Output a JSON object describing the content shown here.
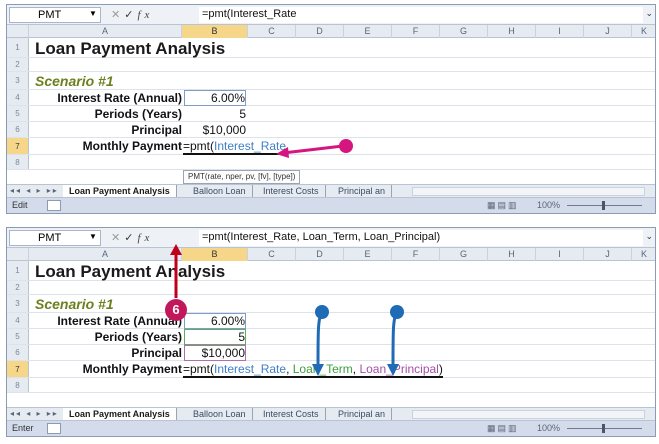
{
  "colors": {
    "callout": "#c2185b",
    "arrow_pink": "#d4167e",
    "arrow_blue": "#1f6bb5",
    "arrow_red": "#c0001a",
    "scenario_green": "#6d7f1e"
  },
  "columns": [
    "A",
    "B",
    "C",
    "D",
    "E",
    "F",
    "G",
    "H",
    "I",
    "J",
    "K"
  ],
  "shot1": {
    "name_box": "PMT",
    "formula_bar": "=pmt(Interest_Rate",
    "rows": [
      "1",
      "2",
      "3",
      "4",
      "5",
      "6",
      "7",
      "8"
    ],
    "title": "Loan Payment Analysis",
    "scenario": "Scenario #1",
    "labels": [
      "Interest Rate (Annual)",
      "Periods (Years)",
      "Principal",
      "Monthly Payment"
    ],
    "values": [
      "6.00%",
      "5",
      "$10,000"
    ],
    "formula_prefix": "=pmt(",
    "formula_arg1": "Interest_Rate",
    "tooltip": "PMT(rate, nper, pv, [fv], [type])",
    "tabs": [
      "Loan Payment Analysis",
      "Balloon Loan",
      "Interest Costs",
      "Principal an"
    ],
    "status_mode": "Edit",
    "zoom": "100%"
  },
  "shot2": {
    "name_box": "PMT",
    "formula_bar": "=pmt(Interest_Rate, Loan_Term, Loan_Principal)",
    "rows": [
      "1",
      "2",
      "3",
      "4",
      "5",
      "6",
      "7",
      "8"
    ],
    "title": "Loan Payment Analysis",
    "scenario": "Scenario #1",
    "labels": [
      "Interest Rate (Annual)",
      "Periods (Years)",
      "Principal",
      "Monthly Payment"
    ],
    "values": [
      "6.00%",
      "5",
      "$10,000"
    ],
    "formula_prefix": "=pmt(",
    "formula_arg1": "Interest_Rate",
    "formula_arg2": "Loan_Term",
    "formula_arg3": "Loan_Principal",
    "formula_suffix": ")",
    "tabs": [
      "Loan Payment Analysis",
      "Balloon Loan",
      "Interest Costs",
      "Principal an"
    ],
    "status_mode": "Enter",
    "zoom": "100%",
    "callout_number": "6"
  }
}
